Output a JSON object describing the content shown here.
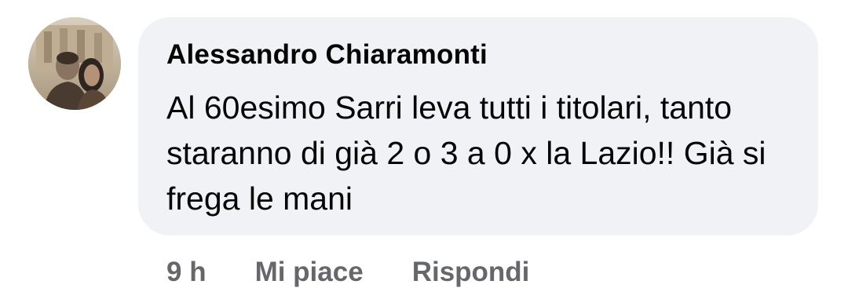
{
  "comment": {
    "author": "Alessandro Chiaramonti",
    "text": "Al 60esimo Sarri leva tutti i titolari, tanto staranno di già 2 o 3 a 0 x la Lazio!! Già si frega le mani",
    "avatar_icon": "profile-photo",
    "time": "9 h",
    "like_label": "Mi piace",
    "reply_label": "Rispondi"
  },
  "colors": {
    "bubble": "#f0f2f5",
    "text": "#050505",
    "meta": "#65676b"
  }
}
